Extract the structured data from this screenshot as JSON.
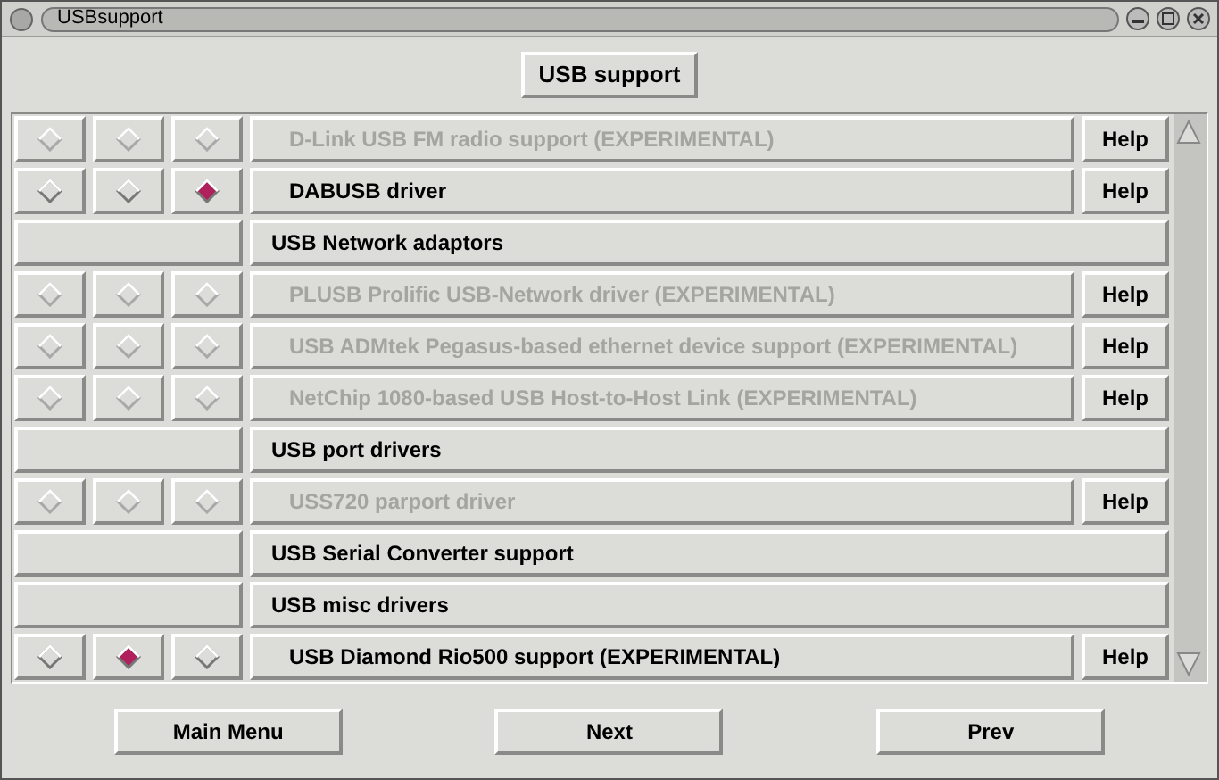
{
  "window": {
    "title": "USBsupport"
  },
  "header_button": "USB support",
  "rows": [
    {
      "kind": "option",
      "label": "D-Link USB FM radio support (EXPERIMENTAL)",
      "disabled": true,
      "choices": [
        {
          "selected": false
        },
        {
          "selected": false
        },
        {
          "selected": false
        }
      ],
      "help": "Help"
    },
    {
      "kind": "option",
      "label": "DABUSB driver",
      "disabled": false,
      "choices": [
        {
          "selected": false
        },
        {
          "selected": false
        },
        {
          "selected": true
        }
      ],
      "help": "Help"
    },
    {
      "kind": "section",
      "label": "USB Network adaptors"
    },
    {
      "kind": "option",
      "label": "PLUSB Prolific USB-Network driver (EXPERIMENTAL)",
      "disabled": true,
      "choices": [
        {
          "selected": false
        },
        {
          "selected": false
        },
        {
          "selected": false
        }
      ],
      "help": "Help"
    },
    {
      "kind": "option",
      "label": "USB ADMtek Pegasus-based ethernet device support (EXPERIMENTAL)",
      "disabled": true,
      "choices": [
        {
          "selected": false
        },
        {
          "selected": false
        },
        {
          "selected": false
        }
      ],
      "help": "Help"
    },
    {
      "kind": "option",
      "label": "NetChip 1080-based USB Host-to-Host Link (EXPERIMENTAL)",
      "disabled": true,
      "choices": [
        {
          "selected": false
        },
        {
          "selected": false
        },
        {
          "selected": false
        }
      ],
      "help": "Help"
    },
    {
      "kind": "section",
      "label": "USB port drivers"
    },
    {
      "kind": "option",
      "label": "USS720 parport driver",
      "disabled": true,
      "choices": [
        {
          "selected": false
        },
        {
          "selected": false
        },
        {
          "selected": false
        }
      ],
      "help": "Help"
    },
    {
      "kind": "section",
      "label": "USB Serial Converter support"
    },
    {
      "kind": "section",
      "label": "USB misc drivers"
    },
    {
      "kind": "option",
      "label": "USB Diamond Rio500 support (EXPERIMENTAL)",
      "disabled": false,
      "choices": [
        {
          "selected": false
        },
        {
          "selected": true
        },
        {
          "selected": false
        }
      ],
      "help": "Help"
    }
  ],
  "buttons": [
    "Main Menu",
    "Next",
    "Prev"
  ]
}
